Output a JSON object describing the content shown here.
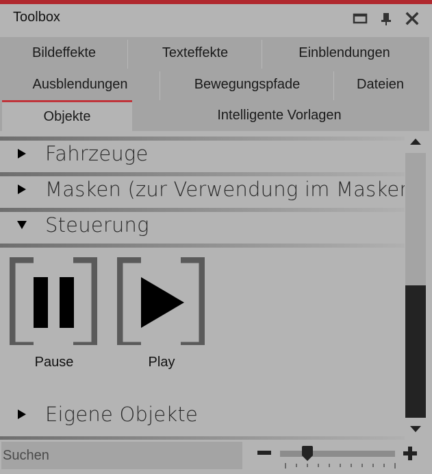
{
  "window": {
    "title": "Toolbox",
    "accent_color": "#b0282e",
    "controls": [
      {
        "name": "maximize",
        "icon": "maximize-icon"
      },
      {
        "name": "pin",
        "icon": "pin-icon"
      },
      {
        "name": "close",
        "icon": "close-icon"
      }
    ]
  },
  "tabs": {
    "rows": [
      [
        "Bildeffekte",
        "Texteffekte",
        "Einblendungen"
      ],
      [
        "Ausblendungen",
        "Bewegungspfade",
        "Dateien"
      ],
      [
        "Objekte",
        "Intelligente Vorlagen"
      ]
    ],
    "active": "Objekte"
  },
  "groups": [
    {
      "title": "Fahrzeuge",
      "expanded": false
    },
    {
      "title": "Masken (zur Verwendung im Masken...",
      "expanded": false
    },
    {
      "title": "Steuerung",
      "expanded": true,
      "items": [
        {
          "label": "Pause",
          "icon": "pause-icon"
        },
        {
          "label": "Play",
          "icon": "play-icon"
        }
      ]
    },
    {
      "title": "Eigene Objekte",
      "expanded": false
    }
  ],
  "scrollbar": {
    "position_fraction": 0.5,
    "visible_fraction": 0.5
  },
  "search": {
    "placeholder": "Suchen",
    "value": ""
  },
  "zoom_slider": {
    "minus_icon": "minus-icon",
    "plus_icon": "plus-icon",
    "tick_count": 11,
    "value_tick_index": 2
  }
}
